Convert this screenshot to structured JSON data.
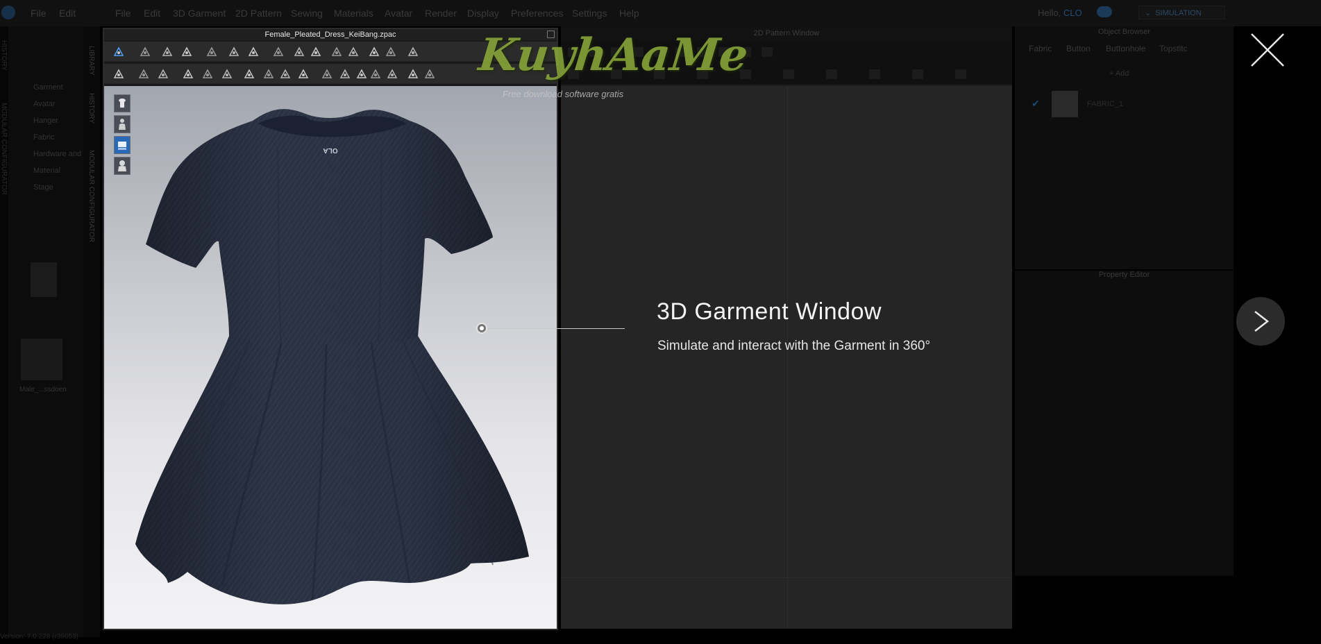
{
  "app": {
    "menu": [
      "File",
      "Edit",
      "3D Garment",
      "2D Pattern",
      "Sewing",
      "Materials",
      "Avatar",
      "Render",
      "Display",
      "Preferences",
      "Settings",
      "Help"
    ],
    "ghost_menu": [
      "File",
      "Edit"
    ],
    "greeting": "Hello,",
    "user": "CLO",
    "simulation": "SIMULATION",
    "version": "Version: 7.0.228 (r39653)"
  },
  "left_panel": {
    "tabs": [
      "HISTORY",
      "MODULAR CONFIGURATOR"
    ],
    "vtabs": [
      "LIBRARY",
      "HISTORY",
      "MODULAR CONFIGURATOR"
    ],
    "items": [
      "Garment",
      "Avatar",
      "Hanger",
      "Fabric",
      "Hardware and",
      "Material",
      "Stage"
    ],
    "thumb_label": "Male_...ssdoen"
  },
  "garment_window": {
    "title": "Female_Pleated_Dress_KeiBang.zpac",
    "label_text": "OLA"
  },
  "pattern_window": {
    "title": "2D Pattern Window"
  },
  "object_browser": {
    "title": "Object Browser",
    "tabs": [
      "Fabric",
      "Button",
      "Buttonhole",
      "Topstitc"
    ],
    "add_label": "Add",
    "fabric_name": "FABRIC_1"
  },
  "property_editor": {
    "title": "Property Editor"
  },
  "overlay": {
    "title": "3D Garment Window",
    "subtitle": "Simulate and interact with the Garment in 360°"
  },
  "watermark": {
    "main": "KuyhAaMe",
    "sub": "Free download software gratis"
  },
  "colors": {
    "accent": "#2a68b8",
    "dress": "#2a3142",
    "overlay_bg": "#000000"
  }
}
